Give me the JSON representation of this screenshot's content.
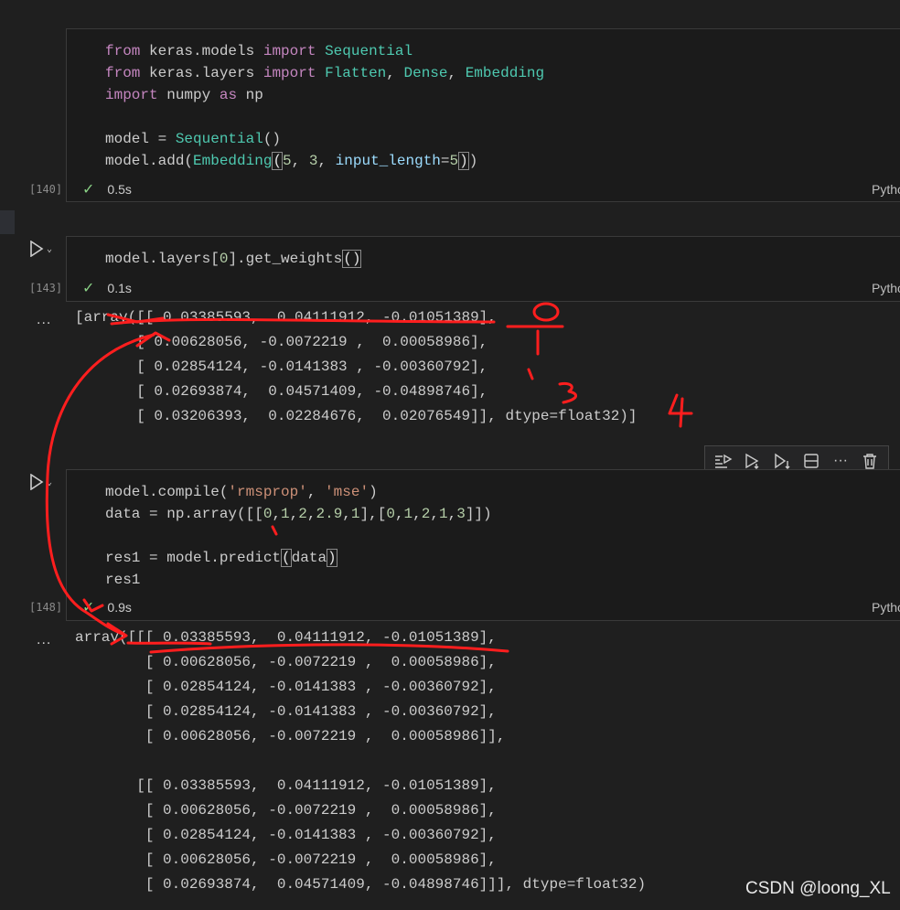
{
  "cells": [
    {
      "exec_count": "[140]",
      "duration": "0.5s",
      "language": "Python"
    },
    {
      "exec_count": "[143]",
      "duration": "0.1s",
      "language": "Python",
      "output": "[array([[ 0.03385593,  0.04111912, -0.01051389],\n       [ 0.00628056, -0.0072219 ,  0.00058986],\n       [ 0.02854124, -0.0141383 , -0.00360792],\n       [ 0.02693874,  0.04571409, -0.04898746],\n       [ 0.03206393,  0.02284676,  0.02076549]], dtype=float32)]"
    },
    {
      "exec_count": "[148]",
      "duration": "0.9s",
      "language": "Python",
      "output": "array([[[ 0.03385593,  0.04111912, -0.01051389],\n        [ 0.00628056, -0.0072219 ,  0.00058986],\n        [ 0.02854124, -0.0141383 , -0.00360792],\n        [ 0.02854124, -0.0141383 , -0.00360792],\n        [ 0.00628056, -0.0072219 ,  0.00058986]],\n\n       [[ 0.03385593,  0.04111912, -0.01051389],\n        [ 0.00628056, -0.0072219 ,  0.00058986],\n        [ 0.02854124, -0.0141383 , -0.00360792],\n        [ 0.00628056, -0.0072219 ,  0.00058986],\n        [ 0.02693874,  0.04571409, -0.04898746]]], dtype=float32)"
    }
  ],
  "code": {
    "c1": {
      "from": "from",
      "import": "import",
      "as": "as",
      "mod_models": "keras.models",
      "mod_layers": "keras.layers",
      "sequential": "Sequential",
      "flatten": "Flatten",
      "dense": "Dense",
      "embedding": "Embedding",
      "numpy": "numpy",
      "np": "np",
      "model_assign": "model = ",
      "model_add": "model.add(",
      "n5": "5",
      "n3": "3",
      "input_length": "input_length",
      "comma_sp": ", ",
      "eq": "="
    },
    "c2": {
      "prefix": "model.layers[",
      "idx": "0",
      "suffix": "].get_weights"
    },
    "c3": {
      "compile_prefix": "model.compile(",
      "s_rmsprop": "'rmsprop'",
      "s_mse": "'mse'",
      "data_prefix": "data = np.array([[",
      "row1": [
        "0",
        "1",
        "2",
        "2.9",
        "1"
      ],
      "row2": [
        "0",
        "1",
        "2",
        "1",
        "3"
      ],
      "res_prefix": "res1 = model.predict",
      "res_arg": "data",
      "res_show": "res1"
    }
  },
  "toolbar": {
    "items": [
      "execute-above-icon",
      "execute-cell-and-below-icon",
      "execute-below-icon",
      "split-cell-icon",
      "more-actions-icon",
      "delete-cell-icon"
    ],
    "more_label": "···"
  },
  "output_prompt": "...",
  "annotations": {
    "labels": [
      "0",
      "1",
      "3",
      "4"
    ],
    "color": "#ff1e1e"
  },
  "watermark": "CSDN @loong_XL",
  "colors": {
    "background": "#1f1f1f",
    "cell_bg": "#1b1b1b",
    "keyword": "#c586c0",
    "class": "#4ec9b0",
    "number": "#b5cea8",
    "string": "#ce9178",
    "param": "#9cdcfe",
    "success": "#89d185"
  }
}
